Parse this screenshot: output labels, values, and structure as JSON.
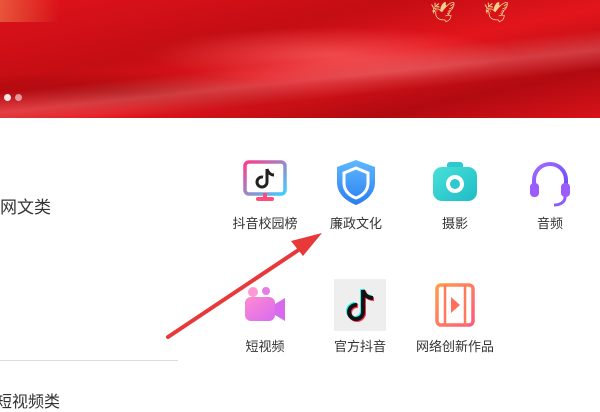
{
  "banner": {
    "colors": {
      "primary": "#d7121a",
      "gold": "#f6d08a"
    },
    "carousel_dots": 2
  },
  "left_column": {
    "category_1": "网文类",
    "category_2": "短视频类"
  },
  "grid": {
    "items": [
      {
        "label": "抖音校园榜",
        "icon": "tiktok-monitor-icon"
      },
      {
        "label": "廉政文化",
        "icon": "shield-icon"
      },
      {
        "label": "摄影",
        "icon": "camera-icon"
      },
      {
        "label": "音频",
        "icon": "headset-icon"
      },
      {
        "label": "短视频",
        "icon": "video-camera-icon"
      },
      {
        "label": "官方抖音",
        "icon": "tiktok-logo-icon"
      },
      {
        "label": "网络创新作品",
        "icon": "film-play-icon"
      }
    ]
  },
  "annotation": {
    "arrow_color": "#e8393a"
  }
}
